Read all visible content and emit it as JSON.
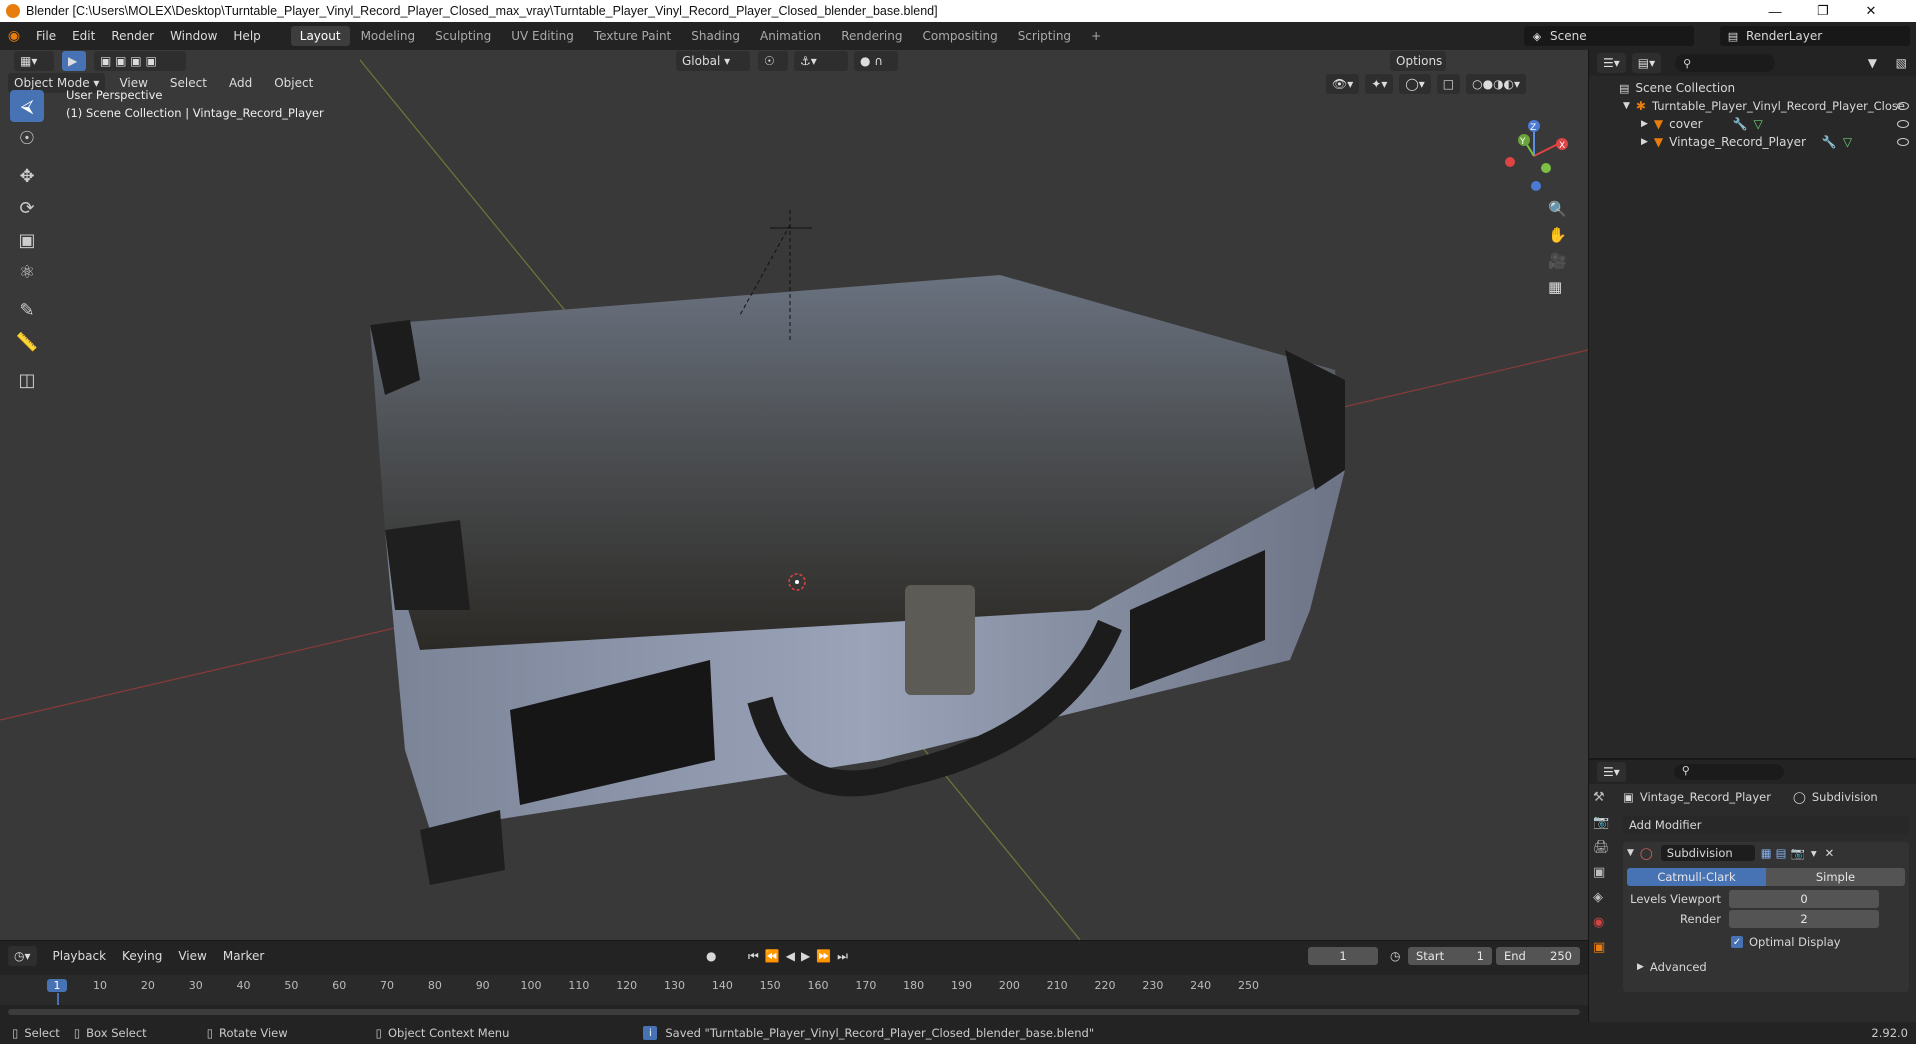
{
  "titlebar": {
    "text": "Blender [C:\\Users\\MOLEX\\Desktop\\Turntable_Player_Vinyl_Record_Player_Closed_max_vray\\Turntable_Player_Vinyl_Record_Player_Closed_blender_base.blend]"
  },
  "menus": [
    "File",
    "Edit",
    "Render",
    "Window",
    "Help"
  ],
  "workspaces": [
    "Layout",
    "Modeling",
    "Sculpting",
    "UV Editing",
    "Texture Paint",
    "Shading",
    "Animation",
    "Rendering",
    "Compositing",
    "Scripting"
  ],
  "scene": {
    "label": "Scene",
    "render_layer": "RenderLayer"
  },
  "viewport_header": {
    "mode": "Object Mode",
    "view": "View",
    "select": "Select",
    "add": "Add",
    "object": "Object",
    "transform": "Global",
    "options": "Options"
  },
  "viewport": {
    "perspective": "User Perspective",
    "collection_info": "(1) Scene Collection | Vintage_Record_Player"
  },
  "gizmo": {
    "x": "X",
    "y": "Y",
    "z": "Z"
  },
  "outliner": {
    "root": "Scene Collection",
    "items": [
      {
        "label": "Turntable_Player_Vinyl_Record_Player_Close"
      },
      {
        "label": "cover"
      },
      {
        "label": "Vintage_Record_Player"
      }
    ]
  },
  "properties": {
    "object_name": "Vintage_Record_Player",
    "modifier_tab": "Subdivision",
    "add_modifier": "Add Modifier",
    "modifier_name": "Subdivision",
    "catmull": "Catmull-Clark",
    "simple": "Simple",
    "levels_viewport_label": "Levels Viewport",
    "levels_viewport_value": "0",
    "render_label": "Render",
    "render_value": "2",
    "optimal_display": "Optimal Display",
    "advanced": "Advanced"
  },
  "timeline": {
    "playback": "Playback",
    "keying": "Keying",
    "view": "View",
    "marker": "Marker",
    "current_frame": "1",
    "start_label": "Start",
    "start": "1",
    "end_label": "End",
    "end": "250",
    "ticks": [
      "1",
      "10",
      "20",
      "30",
      "40",
      "50",
      "60",
      "70",
      "80",
      "90",
      "100",
      "110",
      "120",
      "130",
      "140",
      "150",
      "160",
      "170",
      "180",
      "190",
      "200",
      "210",
      "220",
      "230",
      "240",
      "250"
    ]
  },
  "statusbar": {
    "select": "Select",
    "box_select": "Box Select",
    "rotate_view": "Rotate View",
    "context_menu": "Object Context Menu",
    "message": "Saved \"Turntable_Player_Vinyl_Record_Player_Closed_blender_base.blend\"",
    "version": "2.92.0"
  }
}
